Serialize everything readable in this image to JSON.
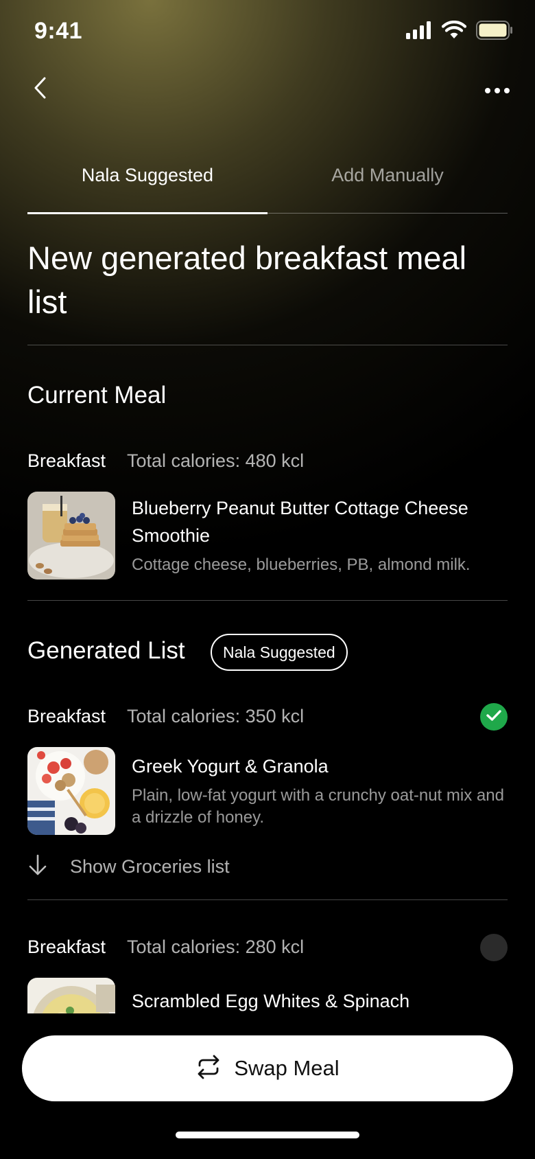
{
  "status_bar": {
    "time": "9:41",
    "icons": [
      "cellular-signal-icon",
      "wifi-icon",
      "battery-icon"
    ]
  },
  "nav": {
    "back_icon": "chevron-left-icon",
    "more_icon": "more-horizontal-icon"
  },
  "tabs": [
    {
      "label": "Nala Suggested",
      "active": true
    },
    {
      "label": "Add Manually",
      "active": false
    }
  ],
  "page_title": "New generated breakfast meal list",
  "current_meal": {
    "section_title": "Current Meal",
    "meal_type": "Breakfast",
    "calories": "Total calories: 480 kcl",
    "name": "Blueberry Peanut Butter Cottage Cheese Smoothie",
    "description": "Cottage cheese, blueberries, PB, almond milk."
  },
  "generated_list": {
    "section_title": "Generated List",
    "badge": "Nala Suggested",
    "items": [
      {
        "meal_type": "Breakfast",
        "calories": "Total calories: 350 kcl",
        "name": "Greek Yogurt & Granola",
        "description": "Plain, low-fat yogurt with a crunchy oat-nut mix and a drizzle of honey.",
        "selected": true,
        "groceries_label": "Show Groceries list"
      },
      {
        "meal_type": "Breakfast",
        "calories": "Total calories: 280 kcl",
        "name": "Scrambled Egg Whites & Spinach",
        "selected": false
      }
    ]
  },
  "primary_action": {
    "label": "Swap Meal",
    "icon": "swap-arrows-icon"
  },
  "colors": {
    "accent_green": "#1fa84a",
    "header_gradient": "#807740",
    "background": "#000000"
  }
}
